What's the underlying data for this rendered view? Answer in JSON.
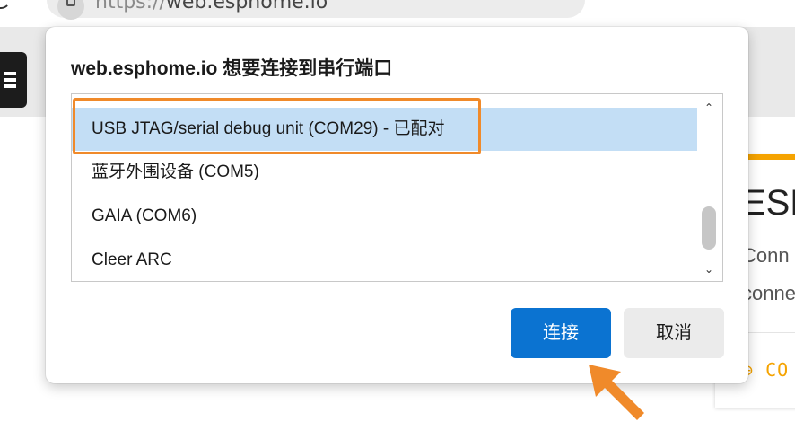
{
  "browser": {
    "url_scheme": "https://",
    "url_host": "web.esphome.io"
  },
  "background_page": {
    "card_title": "ESP",
    "card_line1": "Conn",
    "card_line2": "conne",
    "card_connect": "⊖ CO"
  },
  "dialog": {
    "title": "web.esphome.io 想要连接到串行端口",
    "ports": [
      {
        "label": "USB JTAG/serial debug unit (COM29) - 已配对",
        "selected": true
      },
      {
        "label": "蓝牙外围设备 (COM5)",
        "selected": false
      },
      {
        "label": "GAIA (COM6)",
        "selected": false
      },
      {
        "label": "Cleer ARC",
        "selected": false
      }
    ],
    "connect_label": "连接",
    "cancel_label": "取消"
  },
  "colors": {
    "selection": "#c3def5",
    "primary_button": "#0b73d1",
    "annotation": "#f08a2a",
    "accent": "#f5a300"
  },
  "icons": {
    "scroll_up": "⌃",
    "scroll_down": "⌄"
  }
}
